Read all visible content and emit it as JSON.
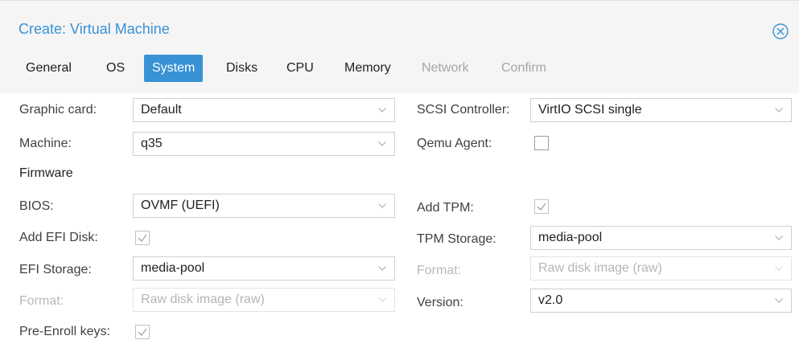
{
  "window": {
    "title": "Create: Virtual Machine"
  },
  "tabs": [
    {
      "label": "General"
    },
    {
      "label": "OS"
    },
    {
      "label": "System"
    },
    {
      "label": "Disks"
    },
    {
      "label": "CPU"
    },
    {
      "label": "Memory"
    },
    {
      "label": "Network"
    },
    {
      "label": "Confirm"
    }
  ],
  "active_tab": "System",
  "form": {
    "graphic_card": {
      "label": "Graphic card:",
      "value": "Default"
    },
    "machine": {
      "label": "Machine:",
      "value": "q35"
    },
    "firmware_section": "Firmware",
    "bios": {
      "label": "BIOS:",
      "value": "OVMF (UEFI)"
    },
    "add_efi_disk": {
      "label": "Add EFI Disk:",
      "checked": true
    },
    "efi_storage": {
      "label": "EFI Storage:",
      "value": "media-pool"
    },
    "efi_format": {
      "label": "Format:",
      "value": "Raw disk image (raw)"
    },
    "pre_enroll_keys": {
      "label": "Pre-Enroll keys:",
      "checked": true
    },
    "scsi_controller": {
      "label": "SCSI Controller:",
      "value": "VirtIO SCSI single"
    },
    "qemu_agent": {
      "label": "Qemu Agent:",
      "checked": false
    },
    "add_tpm": {
      "label": "Add TPM:",
      "checked": true
    },
    "tpm_storage": {
      "label": "TPM Storage:",
      "value": "media-pool"
    },
    "tpm_format": {
      "label": "Format:",
      "value": "Raw disk image (raw)"
    },
    "version": {
      "label": "Version:",
      "value": "v2.0"
    }
  },
  "colors": {
    "accent": "#3892d4",
    "header_bg": "#f5f5f5",
    "disabled_text": "#b5b5b5"
  },
  "icons": {
    "close": "circle-x-icon",
    "dropdown": "chevron-down-icon",
    "checkbox_check": "checkmark-icon"
  }
}
